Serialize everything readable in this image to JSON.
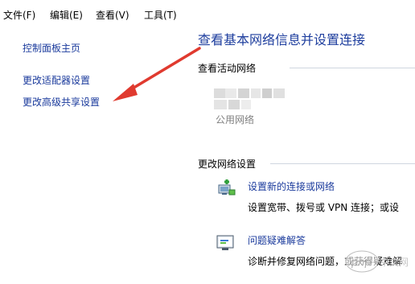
{
  "menubar": {
    "file": "文件(F)",
    "edit": "编辑(E)",
    "view": "查看(V)",
    "tools": "工具(T)"
  },
  "nav": {
    "home": "控制面板主页",
    "adapter_settings": "更改适配器设置",
    "advanced_sharing": "更改高级共享设置"
  },
  "main": {
    "title": "查看基本网络信息并设置连接",
    "active_networks_heading": "查看活动网络",
    "network_type": "公用网络",
    "change_settings_heading": "更改网络设置",
    "actions": [
      {
        "icon": "network-setup-icon",
        "label": "设置新的连接或网络",
        "description": "设置宽带、拨号或 VPN 连接；或设"
      },
      {
        "icon": "troubleshoot-icon",
        "label": "问题疑难解答",
        "description": "诊断并修复网络问题，或获得疑难解"
      }
    ]
  },
  "watermark": {
    "text": "php 中文网"
  },
  "colors": {
    "link": "#1a3a9c",
    "title": "#1e3e9e",
    "arrow": "#e03a2f",
    "rule": "#cfd6e0"
  }
}
